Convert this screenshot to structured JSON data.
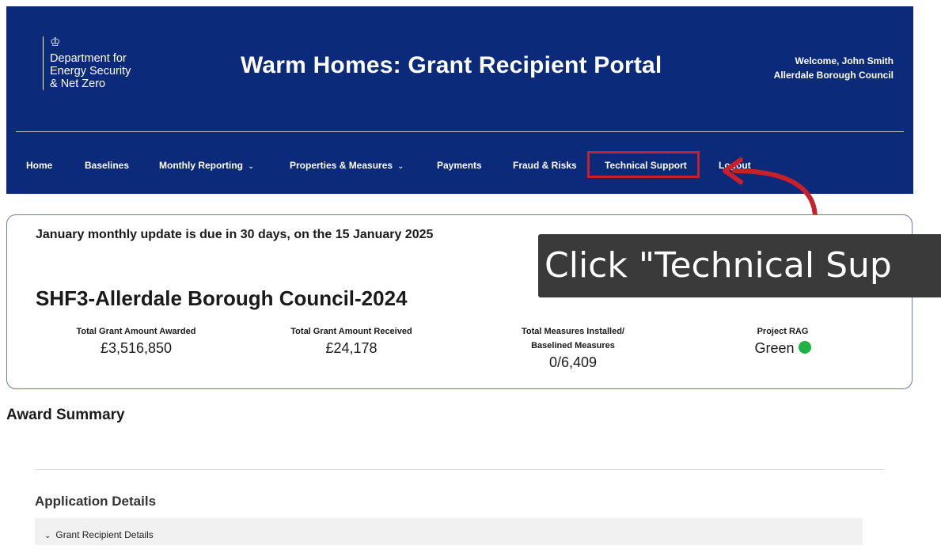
{
  "header": {
    "org_lines": [
      "Department for",
      "Energy Security",
      "& Net Zero"
    ],
    "title": "Warm Homes: Grant Recipient Portal",
    "welcome": "Welcome, John Smith",
    "organisation": "Allerdale Borough Council"
  },
  "nav": {
    "home": "Home",
    "baselines": "Baselines",
    "monthly_reporting": "Monthly Reporting",
    "properties_measures": "Properties & Measures",
    "payments": "Payments",
    "fraud_risks": "Fraud & Risks",
    "technical_support": "Technical Support",
    "logout": "Logout"
  },
  "tooltip": {
    "text": "Click \"Technical Sup"
  },
  "summary": {
    "due_notice": "January monthly update is due in 30 days, on the 15 January 2025",
    "project_name": "SHF3-Allerdale Borough Council-2024",
    "stats": {
      "awarded_label": "Total Grant Amount Awarded",
      "awarded_value": "£3,516,850",
      "received_label": "Total Grant Amount Received",
      "received_value": "£24,178",
      "measures_label_1": "Total Measures Installed/",
      "measures_label_2": "Baselined Measures",
      "measures_value": "0/6,409",
      "rag_label": "Project RAG",
      "rag_value": "Green"
    }
  },
  "award_summary": {
    "title": "Award Summary"
  },
  "application": {
    "title": "Application Details",
    "accordion_label": "Grant Recipient Details"
  },
  "colors": {
    "header_bg": "#0b2a7a",
    "highlight": "#c8202a",
    "rag_green": "#1eb445",
    "tooltip_bg": "#3a3a3a"
  }
}
